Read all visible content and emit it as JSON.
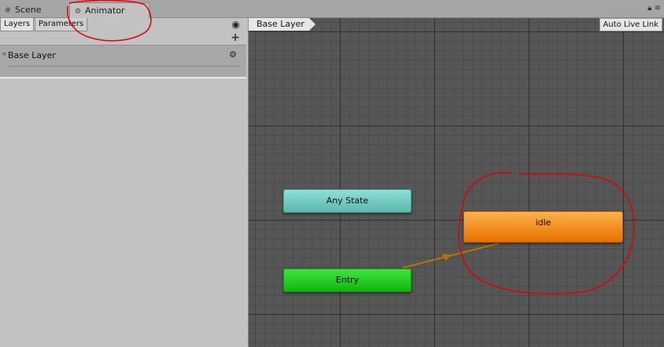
{
  "tabs": [
    {
      "label": "Scene",
      "icon": "grid-icon"
    },
    {
      "label": "Animator",
      "icon": "animator-icon"
    }
  ],
  "left_panel": {
    "tabs": [
      "Layers",
      "Parameters"
    ],
    "layer": {
      "name": "Base Layer"
    }
  },
  "graph": {
    "breadcrumb": "Base Layer",
    "auto_live_link": "Auto Live Link",
    "nodes": {
      "any_state": "Any State",
      "entry": "Entry",
      "idle": "idle"
    }
  },
  "colors": {
    "any_state": "#6fcfc3",
    "entry": "#1fcf1f",
    "idle": "#f08a10",
    "transition": "#b37400",
    "annotation": "#e00000"
  }
}
